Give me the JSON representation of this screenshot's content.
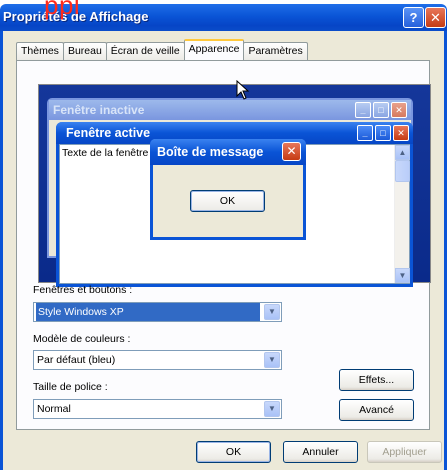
{
  "window": {
    "title": "Propriétés de Affichage",
    "help_glyph": "?",
    "close_glyph": "✕"
  },
  "overlay": {
    "text": "ppl"
  },
  "tabs": [
    {
      "label": "Thèmes",
      "active": false
    },
    {
      "label": "Bureau",
      "active": false
    },
    {
      "label": "Écran de veille",
      "active": false
    },
    {
      "label": "Apparence",
      "active": true
    },
    {
      "label": "Paramètres",
      "active": false
    }
  ],
  "preview": {
    "inactive_title": "Fenêtre inactive",
    "active_title": "Fenêtre active",
    "window_text": "Texte de la fenêtre",
    "msgbox_title": "Boîte de message",
    "msgbox_ok": "OK"
  },
  "fields": {
    "windows_buttons_label": "Fenêtres et boutons :",
    "windows_buttons_value": "Style Windows XP",
    "color_scheme_label": "Modèle de couleurs :",
    "color_scheme_value": "Par défaut (bleu)",
    "font_size_label": "Taille de police :",
    "font_size_value": "Normal"
  },
  "buttons": {
    "effects": "Effets...",
    "advanced": "Avancé",
    "ok": "OK",
    "cancel": "Annuler",
    "apply": "Appliquer"
  },
  "colors": {
    "xp_blue": "#0a54d6",
    "dialog_bg": "#ece9d8",
    "selection": "#316ac5"
  }
}
